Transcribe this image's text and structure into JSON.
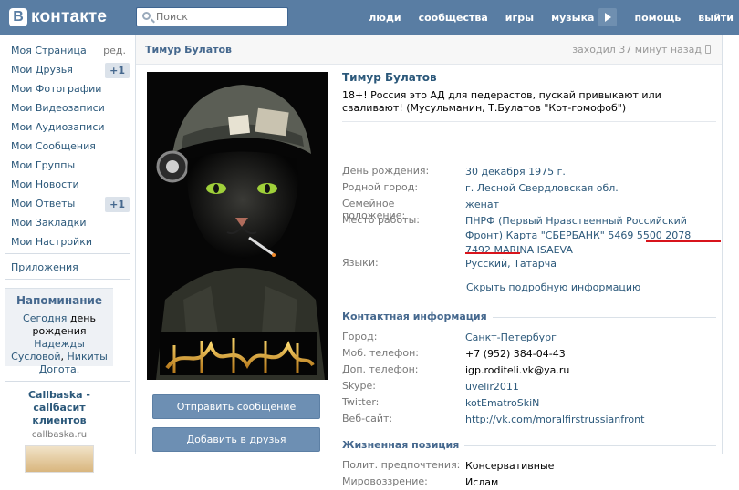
{
  "header": {
    "logo_letter": "В",
    "logo_text": "контакте",
    "search_placeholder": "Поиск",
    "nav": [
      "люди",
      "сообщества",
      "игры",
      "музыка",
      "помощь",
      "выйти"
    ]
  },
  "sidebar": {
    "items": [
      {
        "label": "Моя Страница",
        "extra": "ред."
      },
      {
        "label": "Мои Друзья",
        "badge": "+1"
      },
      {
        "label": "Мои Фотографии"
      },
      {
        "label": "Мои Видеозаписи"
      },
      {
        "label": "Мои Аудиозаписи"
      },
      {
        "label": "Мои Сообщения"
      },
      {
        "label": "Мои Группы"
      },
      {
        "label": "Мои Новости"
      },
      {
        "label": "Мои Ответы",
        "badge": "+1"
      },
      {
        "label": "Мои Закладки"
      },
      {
        "label": "Мои Настройки"
      }
    ],
    "apps": "Приложения",
    "reminder": {
      "title": "Напоминание",
      "today": "Сегодня",
      "text1": "день рождения",
      "link1": "Надежды Сусловой",
      "comma": ",",
      "link2": "Никиты Догота",
      "dot": "."
    },
    "ad": {
      "title": "Callbaska - callбасит клиентов",
      "url": "callbaska.ru"
    }
  },
  "profile": {
    "header_name": "Тимур Булатов",
    "last_seen": "заходил 37 минут назад",
    "name": "Тимур Булатов",
    "status": "18+! Россия это АД для педерастов, пускай привыкают или сваливают! (Мусульманин, Т.Булатов \"Кот-гомофоб\")",
    "avatar_desc": "cat-soldier-image",
    "buttons": {
      "message": "Отправить сообщение",
      "add_friend": "Добавить в друзья"
    },
    "fields": {
      "birthday_label": "День рождения:",
      "birthday": "30 декабря 1975 г.",
      "hometown_label": "Родной город:",
      "hometown": "г. Лесной Свердловская обл.",
      "family_label": "Семейное положение:",
      "family": "женат",
      "work_label": "Место работы:",
      "work": "ПНРФ (Первый Нравственный Российский Фронт) Карта \"СБЕРБАНК\" 5469 5500 2078 7492 MARINA ISAEVA",
      "lang_label": "Языки:",
      "lang": "Русский, Татарча",
      "hide": "Скрыть подробную информацию"
    },
    "contact": {
      "title": "Контактная информация",
      "city_label": "Город:",
      "city": "Санкт-Петербург",
      "mobile_label": "Моб. телефон:",
      "mobile": "+7 (952) 384-04-43",
      "phone_label": "Доп. телефон:",
      "phone": "igp.roditeli.vk@ya.ru",
      "skype_label": "Skype:",
      "skype": "uvelir2011",
      "twitter_label": "Twitter:",
      "twitter": "kotEmatroSkiN",
      "site_label": "Веб-сайт:",
      "site": "http://vk.com/moralfirstrussianfront"
    },
    "life": {
      "title": "Жизненная позиция",
      "polit_label": "Полит. предпочтения:",
      "polit": "Консервативные",
      "world_label": "Мировоззрение:",
      "world": "Ислам"
    }
  },
  "colors": {
    "header": "#597da3",
    "link": "#2b587a",
    "accent_red": "#d8141c"
  }
}
